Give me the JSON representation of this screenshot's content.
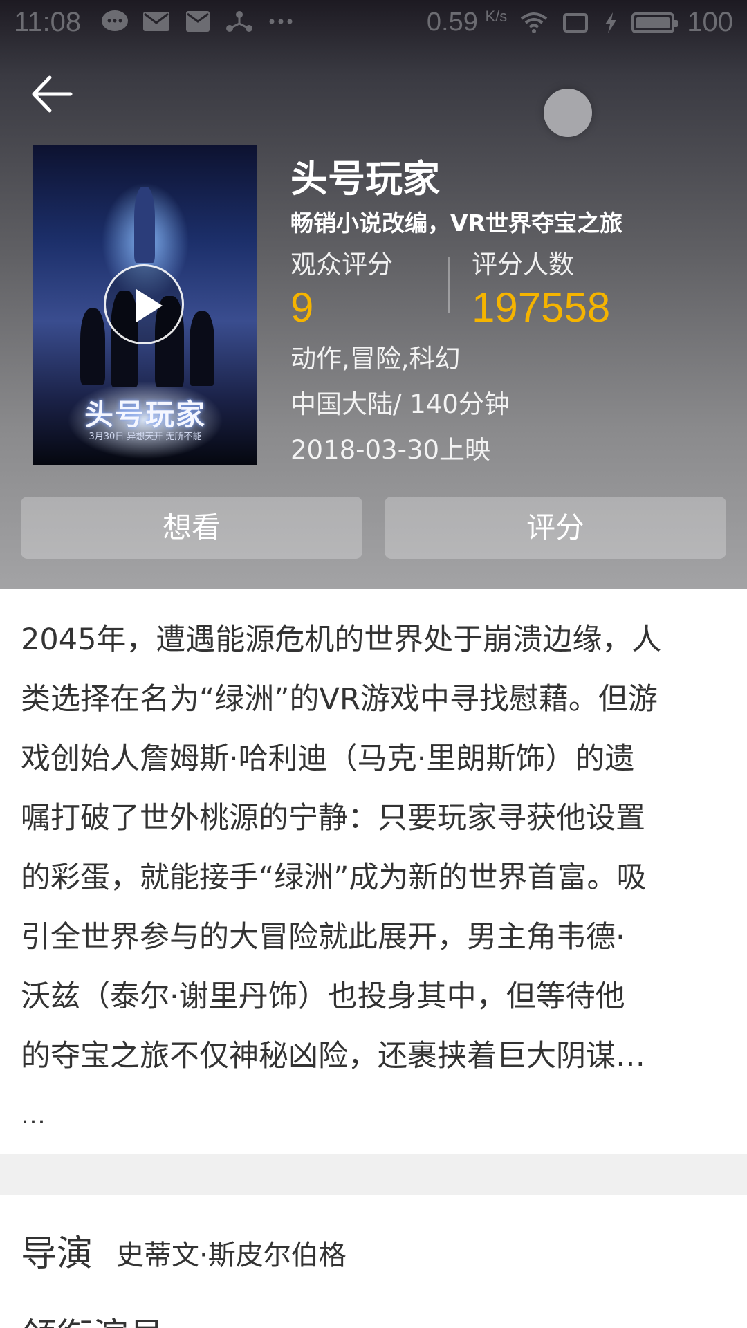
{
  "status_bar": {
    "time": "11:08",
    "speed": "0.59",
    "speed_unit": "K/s",
    "battery": "100",
    "left_icons": [
      "chat-bubble-icon",
      "mail-icon",
      "mail-icon",
      "share-network-icon",
      "more-dots-icon"
    ],
    "right_icons": [
      "wifi-icon",
      "screen-cast-icon",
      "charging-icon",
      "battery-icon"
    ]
  },
  "movie": {
    "title": "头号玩家",
    "tagline": "畅销小说改编，VR世界夺宝之旅",
    "rating_label": "观众评分",
    "rating": "9",
    "rating_count_label": "评分人数",
    "rating_count": "197558",
    "genres": "动作,冒险,科幻",
    "region_duration": "中国大陆/ 140分钟",
    "release": "2018-03-30上映",
    "poster_title": "头号玩家",
    "poster_sub": "3月30日 异想天开 无所不能"
  },
  "actions": {
    "want": "想看",
    "rate": "评分"
  },
  "synopsis": {
    "lines": [
      "2045年，遭遇能源危机的世界处于崩溃边缘，人",
      "类选择在名为“绿洲”的VR游戏中寻找慰藉。但游",
      "戏创始人詹姆斯·哈利迪（马克·里朗斯饰）的遗",
      "嘱打破了世外桃源的宁静：只要玩家寻获他设置",
      "的彩蛋，就能接手“绿洲”成为新的世界首富。吸",
      "引全世界参与的大冒险就此展开，男主角韦德·",
      "沃兹（泰尔·谢里丹饰）也投身其中，但等待他",
      "的夺宝之旅不仅神秘凶险，还裹挟着巨大阴谋…"
    ],
    "more": "…"
  },
  "credits": {
    "director_label": "导演",
    "director": "史蒂文·斯皮尔伯格",
    "cast_label": "领衔演员"
  },
  "colors": {
    "accent": "#f5b400",
    "header_top": "#1d1a22",
    "header_bottom": "#a3a3a5"
  }
}
